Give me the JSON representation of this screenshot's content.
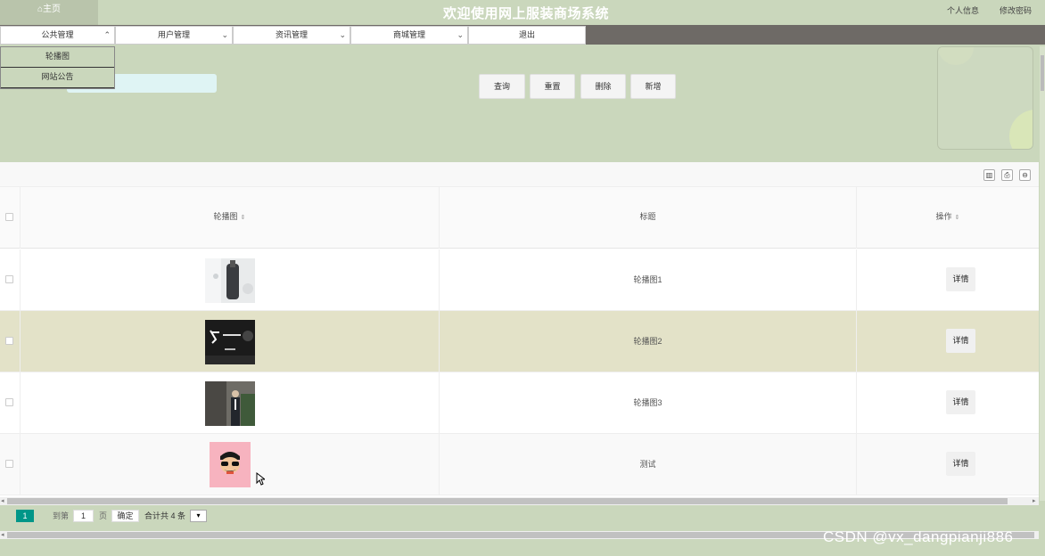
{
  "header": {
    "home_label": "主页",
    "title": "欢迎使用网上服装商场系统",
    "profile_link": "个人信息",
    "password_link": "修改密码"
  },
  "nav": {
    "items": [
      {
        "label": "公共管理",
        "chevron": "up"
      },
      {
        "label": "用户管理",
        "chevron": "down"
      },
      {
        "label": "资讯管理",
        "chevron": "down"
      },
      {
        "label": "商城管理",
        "chevron": "down"
      },
      {
        "label": "退出"
      }
    ],
    "dropdown": [
      "轮播图",
      "网站公告"
    ]
  },
  "search": {
    "placeholder": ""
  },
  "actions": {
    "query": "查询",
    "reset": "重置",
    "delete": "删除",
    "add": "新增"
  },
  "table": {
    "columns": [
      {
        "label": "轮播图",
        "sortable": true
      },
      {
        "label": "标题",
        "sortable": false
      },
      {
        "label": "操作",
        "sortable": true
      }
    ],
    "rows": [
      {
        "title": "轮播图1",
        "action": "详情",
        "image": "product-photo-bottle"
      },
      {
        "title": "轮播图2",
        "action": "详情",
        "image": "banner-dark-calligraphy"
      },
      {
        "title": "轮播图3",
        "action": "详情",
        "image": "banner-man-suit"
      },
      {
        "title": "测试",
        "action": "详情",
        "image": "cartoon-face-pink"
      }
    ],
    "toolbar_icons": [
      "columns-icon",
      "print-icon",
      "export-icon"
    ]
  },
  "pagination": {
    "current_page": "1",
    "goto_prefix": "到第",
    "goto_value": "1",
    "goto_suffix": "页",
    "confirm": "确定",
    "total": "合计共 4 条"
  },
  "watermark": "CSDN @vx_dangpianji886"
}
